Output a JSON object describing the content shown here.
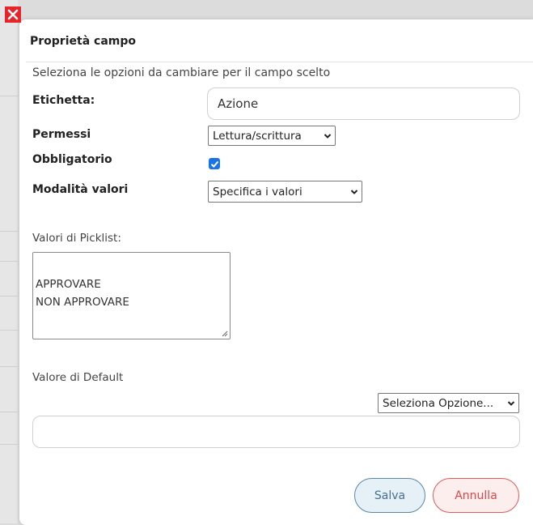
{
  "dialog": {
    "title": "Proprietà campo",
    "subtitle": "Seleziona le opzioni da cambiare per il campo scelto"
  },
  "fields": {
    "label": {
      "caption": "Etichetta:",
      "value": "Azione"
    },
    "permissions": {
      "caption": "Permessi",
      "selected": "Lettura/scrittura"
    },
    "required": {
      "caption": "Obbligatorio",
      "checked": true
    },
    "value_mode": {
      "caption": "Modalità valori",
      "selected": "Specifica i valori"
    },
    "picklist": {
      "caption": "Valori di Picklist:",
      "values": [
        "APPROVARE",
        "NON APPROVARE"
      ]
    },
    "default": {
      "caption": "Valore di Default",
      "selected": "Seleziona Opzione...",
      "value": ""
    }
  },
  "buttons": {
    "save": "Salva",
    "cancel": "Annulla"
  },
  "icons": {
    "close": "close-icon",
    "checkbox_check": "check-icon",
    "select_arrow": "chevron-down-icon",
    "resize": "resize-handle-icon"
  },
  "colors": {
    "close_bg": "#e8242b",
    "checkbox": "#1a73e8",
    "save_border": "#5b86a7",
    "cancel_border": "#e05a5a"
  }
}
